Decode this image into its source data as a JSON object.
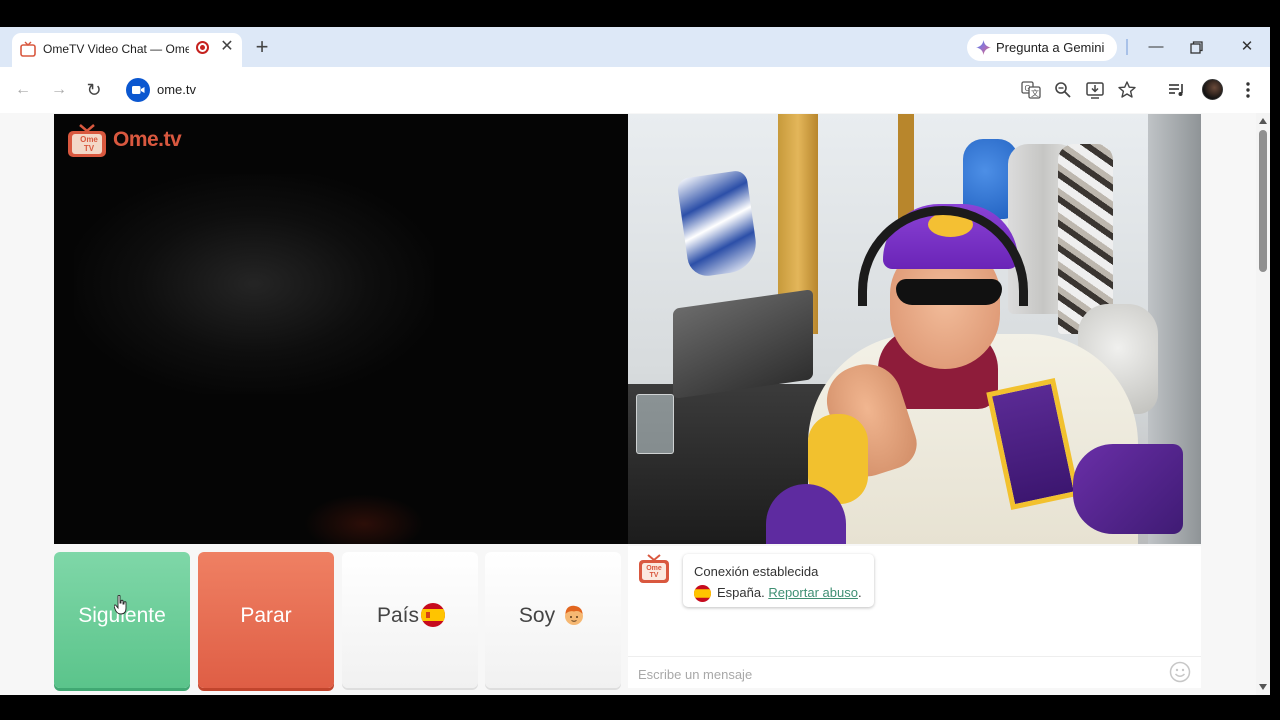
{
  "browser": {
    "tab": {
      "title": "OmeTV Video Chat — Ome"
    },
    "gemini_label": "Pregunta a Gemini",
    "address": "ome.tv"
  },
  "page": {
    "logo_text": "Ome.tv",
    "logo_badge": "Ome TV",
    "buttons": {
      "next": "Siguiente",
      "stop": "Parar",
      "country": "País",
      "gender": "Soy"
    },
    "chat": {
      "badge": "Ome TV",
      "status": "Conexión establecida",
      "country": "España.",
      "report": "Reportar abuso",
      "report_suffix": ".",
      "placeholder": "Escribe un mensaje"
    }
  },
  "colors": {
    "next_top": "#7fd7a8",
    "next_bottom": "#5bc48b",
    "stop_top": "#ef8063",
    "stop_bottom": "#df5e45",
    "logo": "#d9583f",
    "link": "#3f8f73"
  },
  "icons": [
    "favicon-tv-icon",
    "record-icon",
    "close-icon",
    "plus-icon",
    "gemini-star-icon",
    "minimize-icon",
    "restore-icon",
    "back-icon",
    "forward-icon",
    "reload-icon",
    "video-chip-icon",
    "translate-icon",
    "zoom-icon",
    "install-icon",
    "star-icon",
    "media-icon",
    "kebab-menu-icon",
    "spain-flag-icon",
    "boy-emoji-icon",
    "smiley-icon"
  ]
}
